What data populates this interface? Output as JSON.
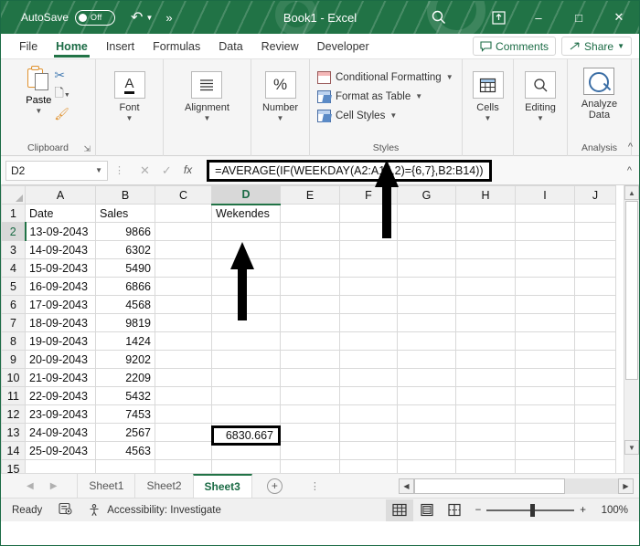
{
  "titlebar": {
    "autosave_label": "AutoSave",
    "autosave_state": "Off",
    "undo_icon": "undo-icon",
    "more_icon": "more-commands-icon",
    "document_title": "Book1  -  Excel",
    "search_icon": "search-icon",
    "ribbon_display_icon": "ribbon-display-options-icon",
    "minimize_icon": "–",
    "maximize_icon": "□",
    "close_icon": "✕"
  },
  "tabs": {
    "items": [
      {
        "label": "File",
        "active": false
      },
      {
        "label": "Home",
        "active": true
      },
      {
        "label": "Insert",
        "active": false
      },
      {
        "label": "Formulas",
        "active": false
      },
      {
        "label": "Data",
        "active": false
      },
      {
        "label": "Review",
        "active": false
      },
      {
        "label": "Developer",
        "active": false
      }
    ],
    "comments_label": "Comments",
    "share_label": "Share"
  },
  "ribbon": {
    "clipboard": {
      "group_label": "Clipboard",
      "paste_label": "Paste",
      "cut_icon": "scissors-icon",
      "copy_icon": "copy-icon",
      "format_painter_icon": "format-painter-icon",
      "dialog_launcher_icon": "dialog-launcher-icon"
    },
    "font": {
      "label": "Font",
      "icon": "font-icon"
    },
    "alignment": {
      "label": "Alignment",
      "icon": "alignment-icon"
    },
    "number": {
      "label": "Number",
      "icon": "percent-icon"
    },
    "styles": {
      "group_label": "Styles",
      "items": [
        "Conditional Formatting",
        "Format as Table",
        "Cell Styles"
      ]
    },
    "cells": {
      "label": "Cells",
      "icon": "cells-icon"
    },
    "editing": {
      "label": "Editing",
      "icon": "magnifier-icon"
    },
    "analysis": {
      "group_label": "Analysis",
      "analyze_label_line1": "Analyze",
      "analyze_label_line2": "Data",
      "icon": "analyze-data-icon"
    },
    "collapse_icon": "collapse-ribbon-icon"
  },
  "formula_bar": {
    "name_box": "D2",
    "cancel_icon": "✕",
    "confirm_icon": "✓",
    "fx_label": "fx",
    "formula": "=AVERAGE(IF(WEEKDAY(A2:A14,2)={6,7},B2:B14))",
    "expand_icon": "expand-formula-bar-icon"
  },
  "grid": {
    "column_headers": [
      "A",
      "B",
      "C",
      "D",
      "E",
      "F",
      "G",
      "H",
      "I",
      "J"
    ],
    "selected_column": "D",
    "selected_row": 2,
    "selected_cell_value": "6830.667",
    "rows": [
      {
        "n": 1,
        "a": "Date",
        "b": "Sales",
        "c": "",
        "d": "Wekendes"
      },
      {
        "n": 2,
        "a": "13-09-2043",
        "b": "9866",
        "c": "",
        "d": ""
      },
      {
        "n": 3,
        "a": "14-09-2043",
        "b": "6302",
        "c": "",
        "d": ""
      },
      {
        "n": 4,
        "a": "15-09-2043",
        "b": "5490",
        "c": "",
        "d": ""
      },
      {
        "n": 5,
        "a": "16-09-2043",
        "b": "6866",
        "c": "",
        "d": ""
      },
      {
        "n": 6,
        "a": "17-09-2043",
        "b": "4568",
        "c": "",
        "d": ""
      },
      {
        "n": 7,
        "a": "18-09-2043",
        "b": "9819",
        "c": "",
        "d": ""
      },
      {
        "n": 8,
        "a": "19-09-2043",
        "b": "1424",
        "c": "",
        "d": ""
      },
      {
        "n": 9,
        "a": "20-09-2043",
        "b": "9202",
        "c": "",
        "d": ""
      },
      {
        "n": 10,
        "a": "21-09-2043",
        "b": "2209",
        "c": "",
        "d": ""
      },
      {
        "n": 11,
        "a": "22-09-2043",
        "b": "5432",
        "c": "",
        "d": ""
      },
      {
        "n": 12,
        "a": "23-09-2043",
        "b": "7453",
        "c": "",
        "d": ""
      },
      {
        "n": 13,
        "a": "24-09-2043",
        "b": "2567",
        "c": "",
        "d": ""
      },
      {
        "n": 14,
        "a": "25-09-2043",
        "b": "4563",
        "c": "",
        "d": ""
      },
      {
        "n": 15,
        "a": "",
        "b": "",
        "c": "",
        "d": ""
      }
    ],
    "annotations": [
      {
        "name": "arrow-pointing-to-formula-bar"
      },
      {
        "name": "arrow-pointing-to-result-cell"
      }
    ]
  },
  "sheet_tabs": {
    "prev_icon": "◀",
    "next_icon": "▶",
    "items": [
      {
        "label": "Sheet1",
        "active": false
      },
      {
        "label": "Sheet2",
        "active": false
      },
      {
        "label": "Sheet3",
        "active": true
      }
    ],
    "add_icon": "+",
    "overflow_icon": "⋮"
  },
  "status_bar": {
    "mode": "Ready",
    "macro_icon": "record-macro-icon",
    "accessibility_icon": "accessibility-icon",
    "accessibility_text": "Accessibility: Investigate",
    "view_normal_icon": "normal-view-icon",
    "view_layout_icon": "page-layout-view-icon",
    "view_break_icon": "page-break-preview-icon",
    "zoom_out_icon": "−",
    "zoom_in_icon": "+",
    "zoom_level": "100%"
  },
  "colors": {
    "brand_green": "#217346",
    "accent_green": "#1b6b45",
    "ribbon_bg": "#f5f5f5",
    "grid_line": "#d9d9d9"
  }
}
